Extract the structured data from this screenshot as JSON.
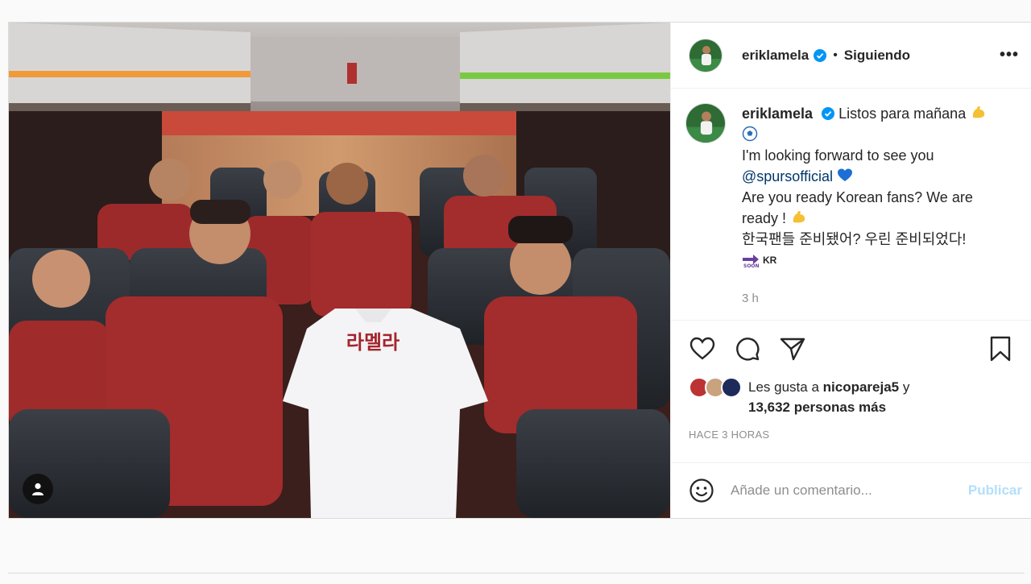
{
  "post": {
    "username": "eriklamela",
    "follow_status": "Siguiendo",
    "more_label": "•••",
    "caption": {
      "line1": "Listos para mañana",
      "line2": "I'm looking forward to see you",
      "mention": "@spursofficial",
      "line3": "Are you ready Korean fans? We are",
      "line4": "ready !",
      "line5": "한국팬들 준비됐어? 우린 준비되었다!",
      "soon_label": "KR"
    },
    "time_short": "3 h",
    "likes": {
      "prefix": "Les gusta a",
      "user": "nicopareja5",
      "connector": "y",
      "count_text": "13,632 personas más"
    },
    "time_long": "HACE 3 HORAS",
    "comment": {
      "placeholder": "Añade un comentario...",
      "publish_label": "Publicar"
    },
    "photo": {
      "shirt_text": "라멜라"
    }
  },
  "colors": {
    "verified": "#0095f6",
    "mention": "#00376b",
    "publish_disabled": "#b2dffc",
    "jersey_red": "#9d2a2a"
  }
}
